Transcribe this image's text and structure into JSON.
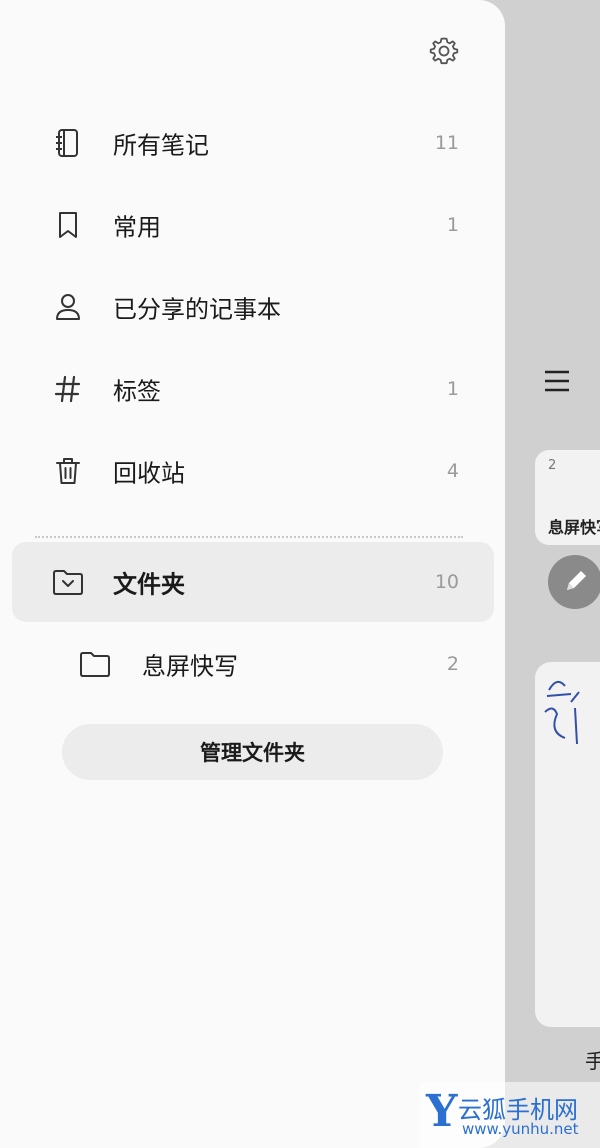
{
  "drawer": {
    "settings_icon": "gear-icon",
    "nav_items": [
      {
        "label": "所有笔记",
        "count": "11",
        "icon": "notebook-icon"
      },
      {
        "label": "常用",
        "count": "1",
        "icon": "bookmark-icon"
      },
      {
        "label": "已分享的记事本",
        "count": "",
        "icon": "person-icon"
      },
      {
        "label": "标签",
        "count": "1",
        "icon": "hashtag-icon"
      },
      {
        "label": "回收站",
        "count": "4",
        "icon": "trash-icon"
      }
    ],
    "folders": {
      "label": "文件夹",
      "count": "10",
      "icon": "folder-chevron-icon",
      "children": [
        {
          "label": "息屏快写",
          "count": "2",
          "icon": "folder-icon"
        }
      ]
    },
    "manage_button_label": "管理文件夹"
  },
  "background": {
    "card_small_count": "2",
    "card_small_title": "息屏快写",
    "caption": "手",
    "handwriting": "云以"
  },
  "watermark": {
    "logo_letter": "Y",
    "name": "云狐手机网",
    "url": "www.yunhu.net"
  },
  "colors": {
    "drawer_bg": "#fafafa",
    "selected_bg": "#ececec",
    "dim_bg": "#d0d0d0",
    "count_text": "#9a9a9a",
    "watermark": "#2b6fd1"
  }
}
